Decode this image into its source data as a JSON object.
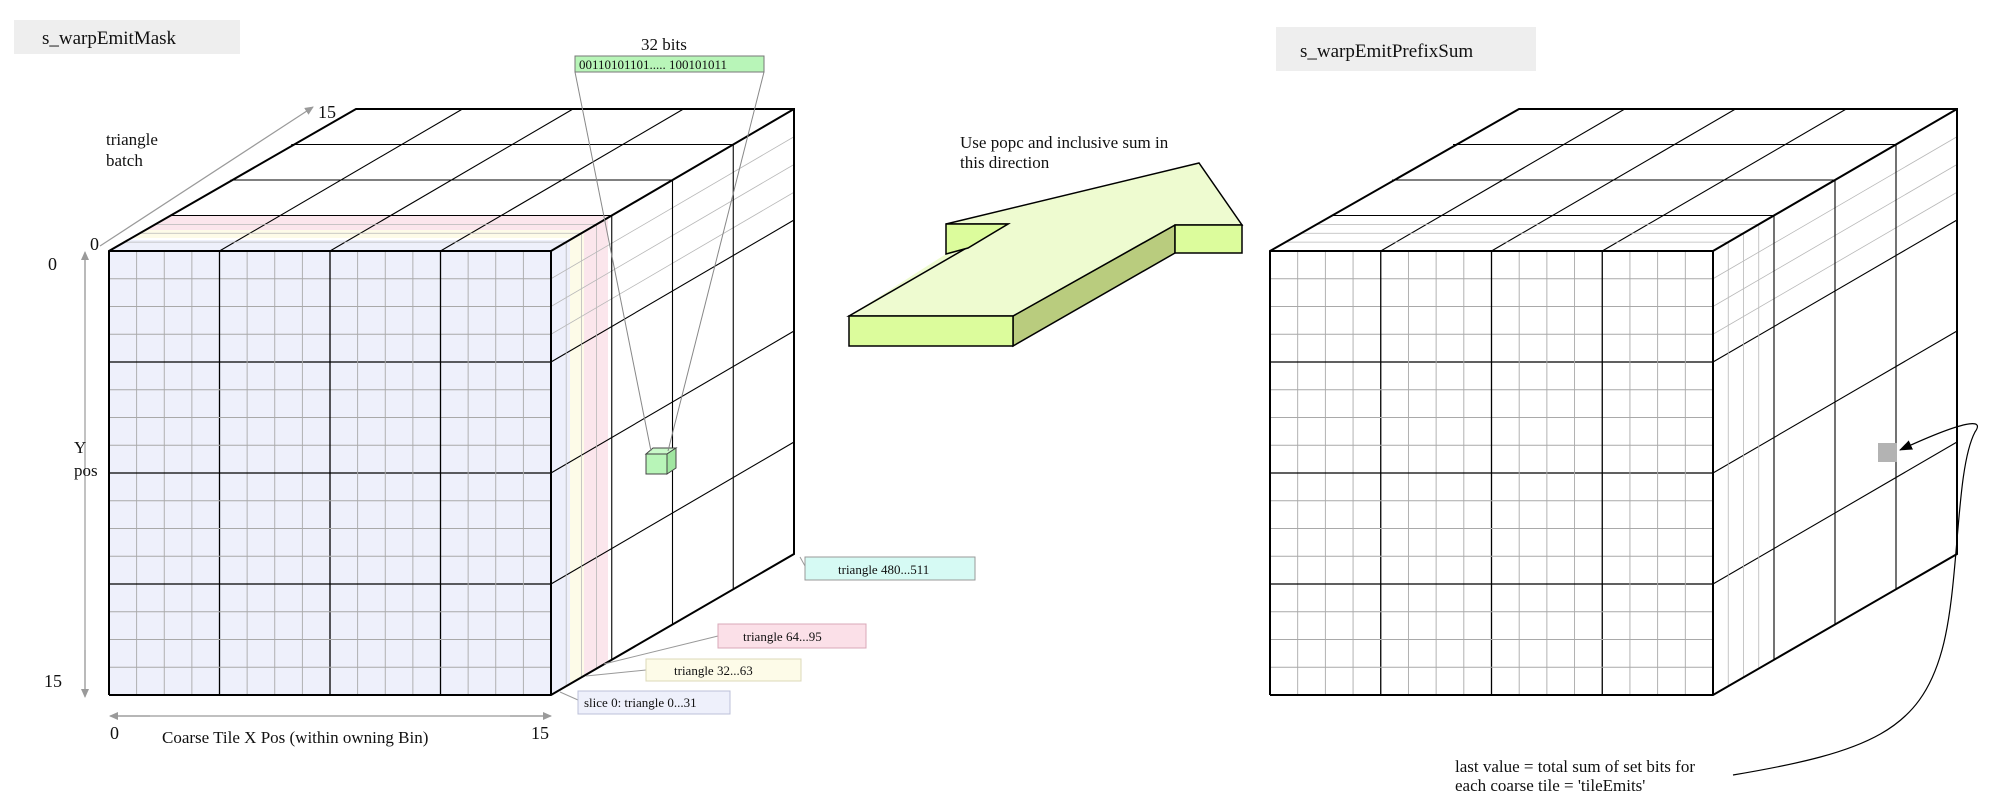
{
  "left_cube": {
    "title": "s_warpEmitMask",
    "bits_label": "32 bits",
    "bits_value": "00110101101..... 100101011",
    "depth_axis_label_line1": "triangle",
    "depth_axis_label_line2": "batch",
    "depth_tick_start": "0",
    "depth_tick_end": "15",
    "y_axis_label_line1": "Y",
    "y_axis_label_line2": "pos",
    "y_tick_start": "0",
    "y_tick_end": "15",
    "x_axis_label": "Coarse Tile X Pos (within owning Bin)",
    "x_tick_start": "0",
    "x_tick_end": "15",
    "slices": [
      {
        "label": "slice 0: triangle 0...31",
        "color": "#eef0fb"
      },
      {
        "label": "triangle 32...63",
        "color": "#fdfbe8"
      },
      {
        "label": "triangle 64...95",
        "color": "#fbe0e8"
      },
      {
        "label": "triangle 480...511",
        "color": "#d6faf4"
      }
    ],
    "highlight_color": "#b8f5b8"
  },
  "arrow": {
    "caption_line1": "Use popc and inclusive sum in",
    "caption_line2": "this direction",
    "fill_color": "#eefbd0",
    "side_color": "#b9cc7e",
    "front_color": "#dcfc9c"
  },
  "right_cube": {
    "title": "s_warpEmitPrefixSum",
    "note_line1": "last value = total sum of set bits for",
    "note_line2": "each coarse tile = 'tileEmits'",
    "marker_color": "#b3b3b3"
  }
}
